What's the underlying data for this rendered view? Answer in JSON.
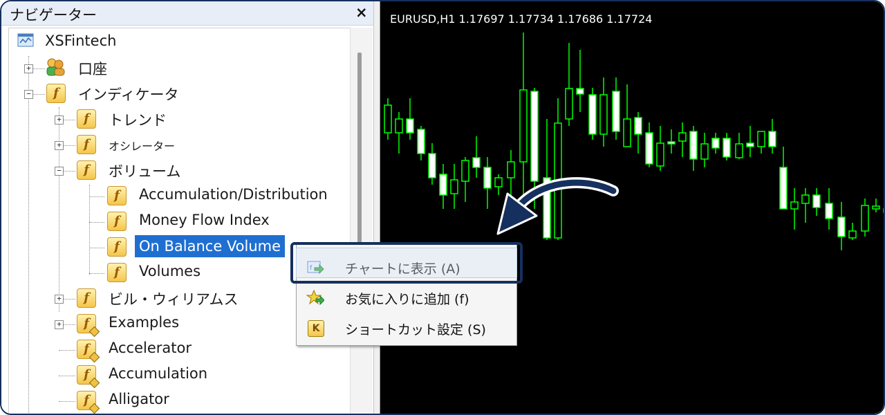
{
  "navigator": {
    "title": "ナビゲーター",
    "close_glyph": "×",
    "tree": [
      {
        "label": "XSFintech",
        "icon": "broker-icon"
      },
      {
        "label": "口座",
        "icon": "accounts-icon",
        "expander": "+"
      },
      {
        "label": "インディケータ",
        "icon": "indicator-folder-icon",
        "expander": "−"
      },
      {
        "label": "トレンド",
        "icon": "indicator-folder-icon",
        "expander": "+"
      },
      {
        "label": "オシレーター",
        "icon": "indicator-folder-icon",
        "expander": "+"
      },
      {
        "label": "ボリューム",
        "icon": "indicator-folder-icon",
        "expander": "−"
      },
      {
        "label": "Accumulation/Distribution",
        "icon": "indicator-icon"
      },
      {
        "label": "Money Flow Index",
        "icon": "indicator-icon"
      },
      {
        "label": "On Balance Volume",
        "icon": "indicator-icon",
        "selected": true
      },
      {
        "label": "Volumes",
        "icon": "indicator-icon"
      },
      {
        "label": "ビル・ウィリアムス",
        "icon": "indicator-folder-icon",
        "expander": "+"
      },
      {
        "label": "Examples",
        "icon": "custom-indicator-icon",
        "expander": "+"
      },
      {
        "label": "Accelerator",
        "icon": "custom-indicator-icon"
      },
      {
        "label": "Accumulation",
        "icon": "custom-indicator-icon"
      },
      {
        "label": "Alligator",
        "icon": "custom-indicator-icon"
      }
    ]
  },
  "chart": {
    "header": "EURUSD,H1  1.17697 1.17734 1.17686 1.17724",
    "colors": {
      "background": "#000000",
      "candle": "#00ff00",
      "bull_body": "#000000",
      "bear_body": "#ffffff"
    }
  },
  "context_menu": {
    "items": [
      {
        "label": "チャートに表示 (A)",
        "icon": "attach-to-chart-icon",
        "highlighted": true
      },
      {
        "label": "お気に入りに追加 (f)",
        "icon": "favorite-star-icon"
      },
      {
        "label": "ショートカット設定 (S)",
        "icon": "shortcut-key-icon",
        "glyph": "K"
      }
    ]
  },
  "annotation": {
    "arrow": "curved-arrow-icon",
    "color": "#15305e"
  }
}
